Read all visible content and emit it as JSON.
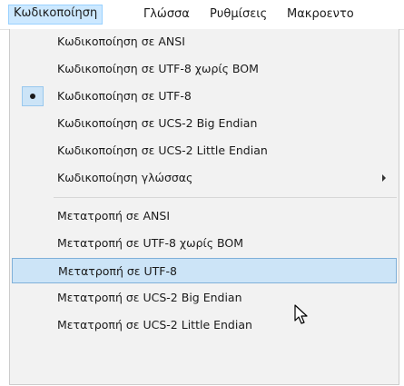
{
  "menubar": {
    "items": [
      {
        "label": "Κωδικοποίηση"
      },
      {
        "label": "Γλώσσα"
      },
      {
        "label": "Ρυθμίσεις"
      },
      {
        "label": "Μακροεντο"
      }
    ]
  },
  "menu": {
    "items": [
      {
        "label": "Κωδικοποίηση σε ANSI"
      },
      {
        "label": "Κωδικοποίηση σε UTF-8 χωρίς BOM"
      },
      {
        "label": "Κωδικοποίηση σε UTF-8"
      },
      {
        "label": "Κωδικοποίηση σε UCS-2 Big Endian"
      },
      {
        "label": "Κωδικοποίηση σε UCS-2 Little Endian"
      },
      {
        "label": "Κωδικοποίηση γλώσσας"
      },
      {
        "label": "Μετατροπή σε ANSI"
      },
      {
        "label": "Μετατροπή σε UTF-8 χωρίς BOM"
      },
      {
        "label": "Μετατροπή σε UTF-8"
      },
      {
        "label": "Μετατροπή σε UCS-2 Big Endian"
      },
      {
        "label": "Μετατροπή σε UCS-2 Little Endian"
      }
    ]
  },
  "icons": {
    "checked_bullet": "radio-bullet-icon",
    "submenu": "submenu-arrow-icon",
    "cursor": "mouse-pointer-icon"
  },
  "colors": {
    "hover": "#cce4f7",
    "hover_border": "#7fb0d9",
    "menu_bg": "#f2f2f2"
  }
}
